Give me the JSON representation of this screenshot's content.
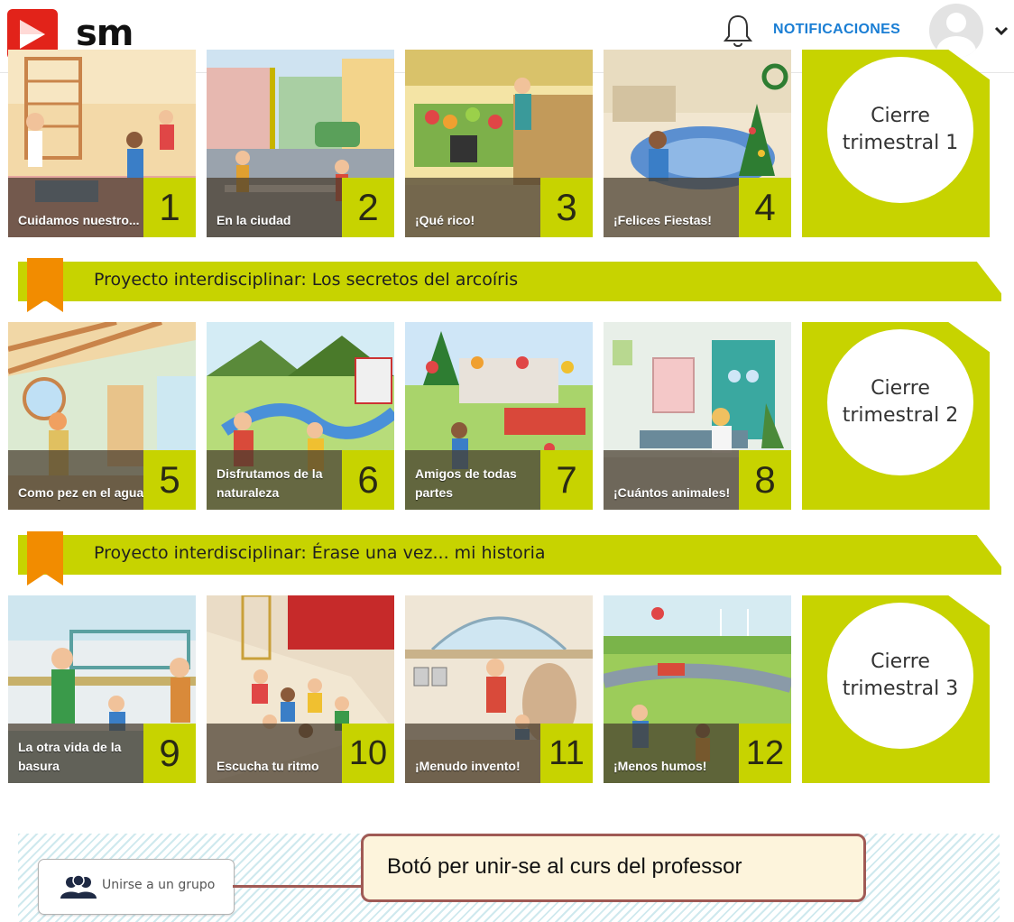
{
  "brand": {
    "logo_text": "sm"
  },
  "header": {
    "notifications_label": "NOTIFICACIONES"
  },
  "rows": [
    {
      "units": [
        {
          "title": "Cuidamos nuestro...",
          "number": "1"
        },
        {
          "title": "En la ciudad",
          "number": "2"
        },
        {
          "title": "¡Qué rico!",
          "number": "3"
        },
        {
          "title": "¡Felices Fiestas!",
          "number": "4"
        }
      ],
      "cierre": "Cierre\ntrimestral 1"
    },
    {
      "units": [
        {
          "title": "Como pez en el agua",
          "number": "5"
        },
        {
          "title": "Disfrutamos de la naturaleza",
          "number": "6"
        },
        {
          "title": "Amigos de todas partes",
          "number": "7"
        },
        {
          "title": "¡Cuántos animales!",
          "number": "8"
        }
      ],
      "cierre": "Cierre\ntrimestral 2"
    },
    {
      "units": [
        {
          "title": "La otra vida de la basura",
          "number": "9"
        },
        {
          "title": "Escucha tu ritmo",
          "number": "10"
        },
        {
          "title": "¡Menudo invento!",
          "number": "11"
        },
        {
          "title": "¡Menos humos!",
          "number": "12"
        }
      ],
      "cierre": "Cierre\ntrimestral 3"
    }
  ],
  "projects": [
    {
      "label": "Proyecto interdisciplinar: Los secretos del arcoíris"
    },
    {
      "label": "Proyecto interdisciplinar: Érase una vez... mi historia"
    }
  ],
  "join": {
    "label": "Unirse a un grupo"
  },
  "callout": {
    "text": "Botó per unir-se al curs del professor"
  },
  "colors": {
    "accent": "#c7d300",
    "ribbon": "#f28c00",
    "link": "#1a7ed4",
    "logo": "#e2231a"
  },
  "icons": [
    "bell-icon",
    "chevron-down-icon",
    "group-icon",
    "bookmark-icon"
  ]
}
